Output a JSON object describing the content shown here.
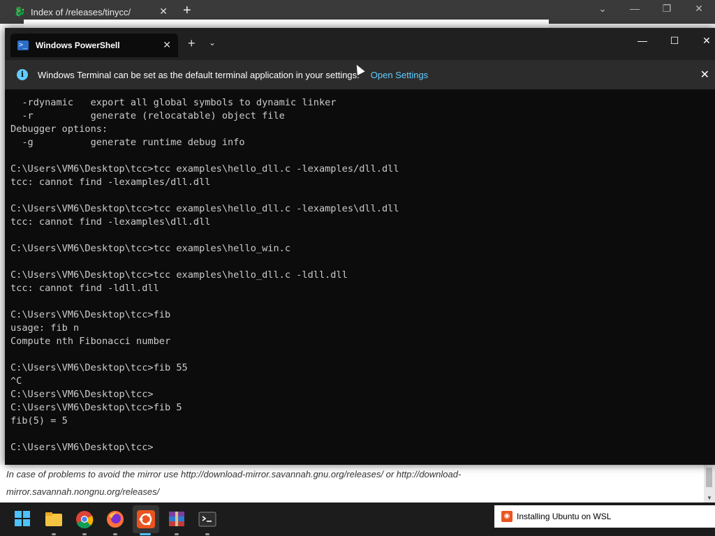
{
  "browser": {
    "tab_title": "Index of /releases/tinycc/",
    "content_lines": [
      "In case of problems to avoid the mirror use http://download-mirror.savannah.gnu.org/releases/ or http://download-",
      "mirror.savannah.nongnu.org/releases/"
    ]
  },
  "terminal": {
    "tab_title": "Windows PowerShell",
    "info_text": "Windows Terminal can be set as the default terminal application in your settings.",
    "info_link": "Open Settings",
    "lines": [
      "  -rdynamic   export all global symbols to dynamic linker",
      "  -r          generate (relocatable) object file",
      "Debugger options:",
      "  -g          generate runtime debug info",
      "",
      "C:\\Users\\VM6\\Desktop\\tcc>tcc examples\\hello_dll.c -lexamples/dll.dll",
      "tcc: cannot find -lexamples/dll.dll",
      "",
      "C:\\Users\\VM6\\Desktop\\tcc>tcc examples\\hello_dll.c -lexamples\\dll.dll",
      "tcc: cannot find -lexamples\\dll.dll",
      "",
      "C:\\Users\\VM6\\Desktop\\tcc>tcc examples\\hello_win.c",
      "",
      "C:\\Users\\VM6\\Desktop\\tcc>tcc examples\\hello_dll.c -ldll.dll",
      "tcc: cannot find -ldll.dll",
      "",
      "C:\\Users\\VM6\\Desktop\\tcc>fib",
      "usage: fib n",
      "Compute nth Fibonacci number",
      "",
      "C:\\Users\\VM6\\Desktop\\tcc>fib 55",
      "^C",
      "C:\\Users\\VM6\\Desktop\\tcc>",
      "C:\\Users\\VM6\\Desktop\\tcc>fib 5",
      "fib(5) = 5",
      "",
      "C:\\Users\\VM6\\Desktop\\tcc>"
    ]
  },
  "taskbar": {
    "notification": "Installing Ubuntu on WSL",
    "apps": [
      "windows-start-icon",
      "file-explorer-icon",
      "chrome-icon",
      "firefox-icon",
      "ubuntu-icon",
      "winrar-icon",
      "terminal-icon"
    ]
  },
  "colors": {
    "terminal_bg": "#0c0c0c",
    "terminal_fg": "#cccccc",
    "link_accent": "#60cdff",
    "taskbar_bg": "#1c1c1c"
  }
}
